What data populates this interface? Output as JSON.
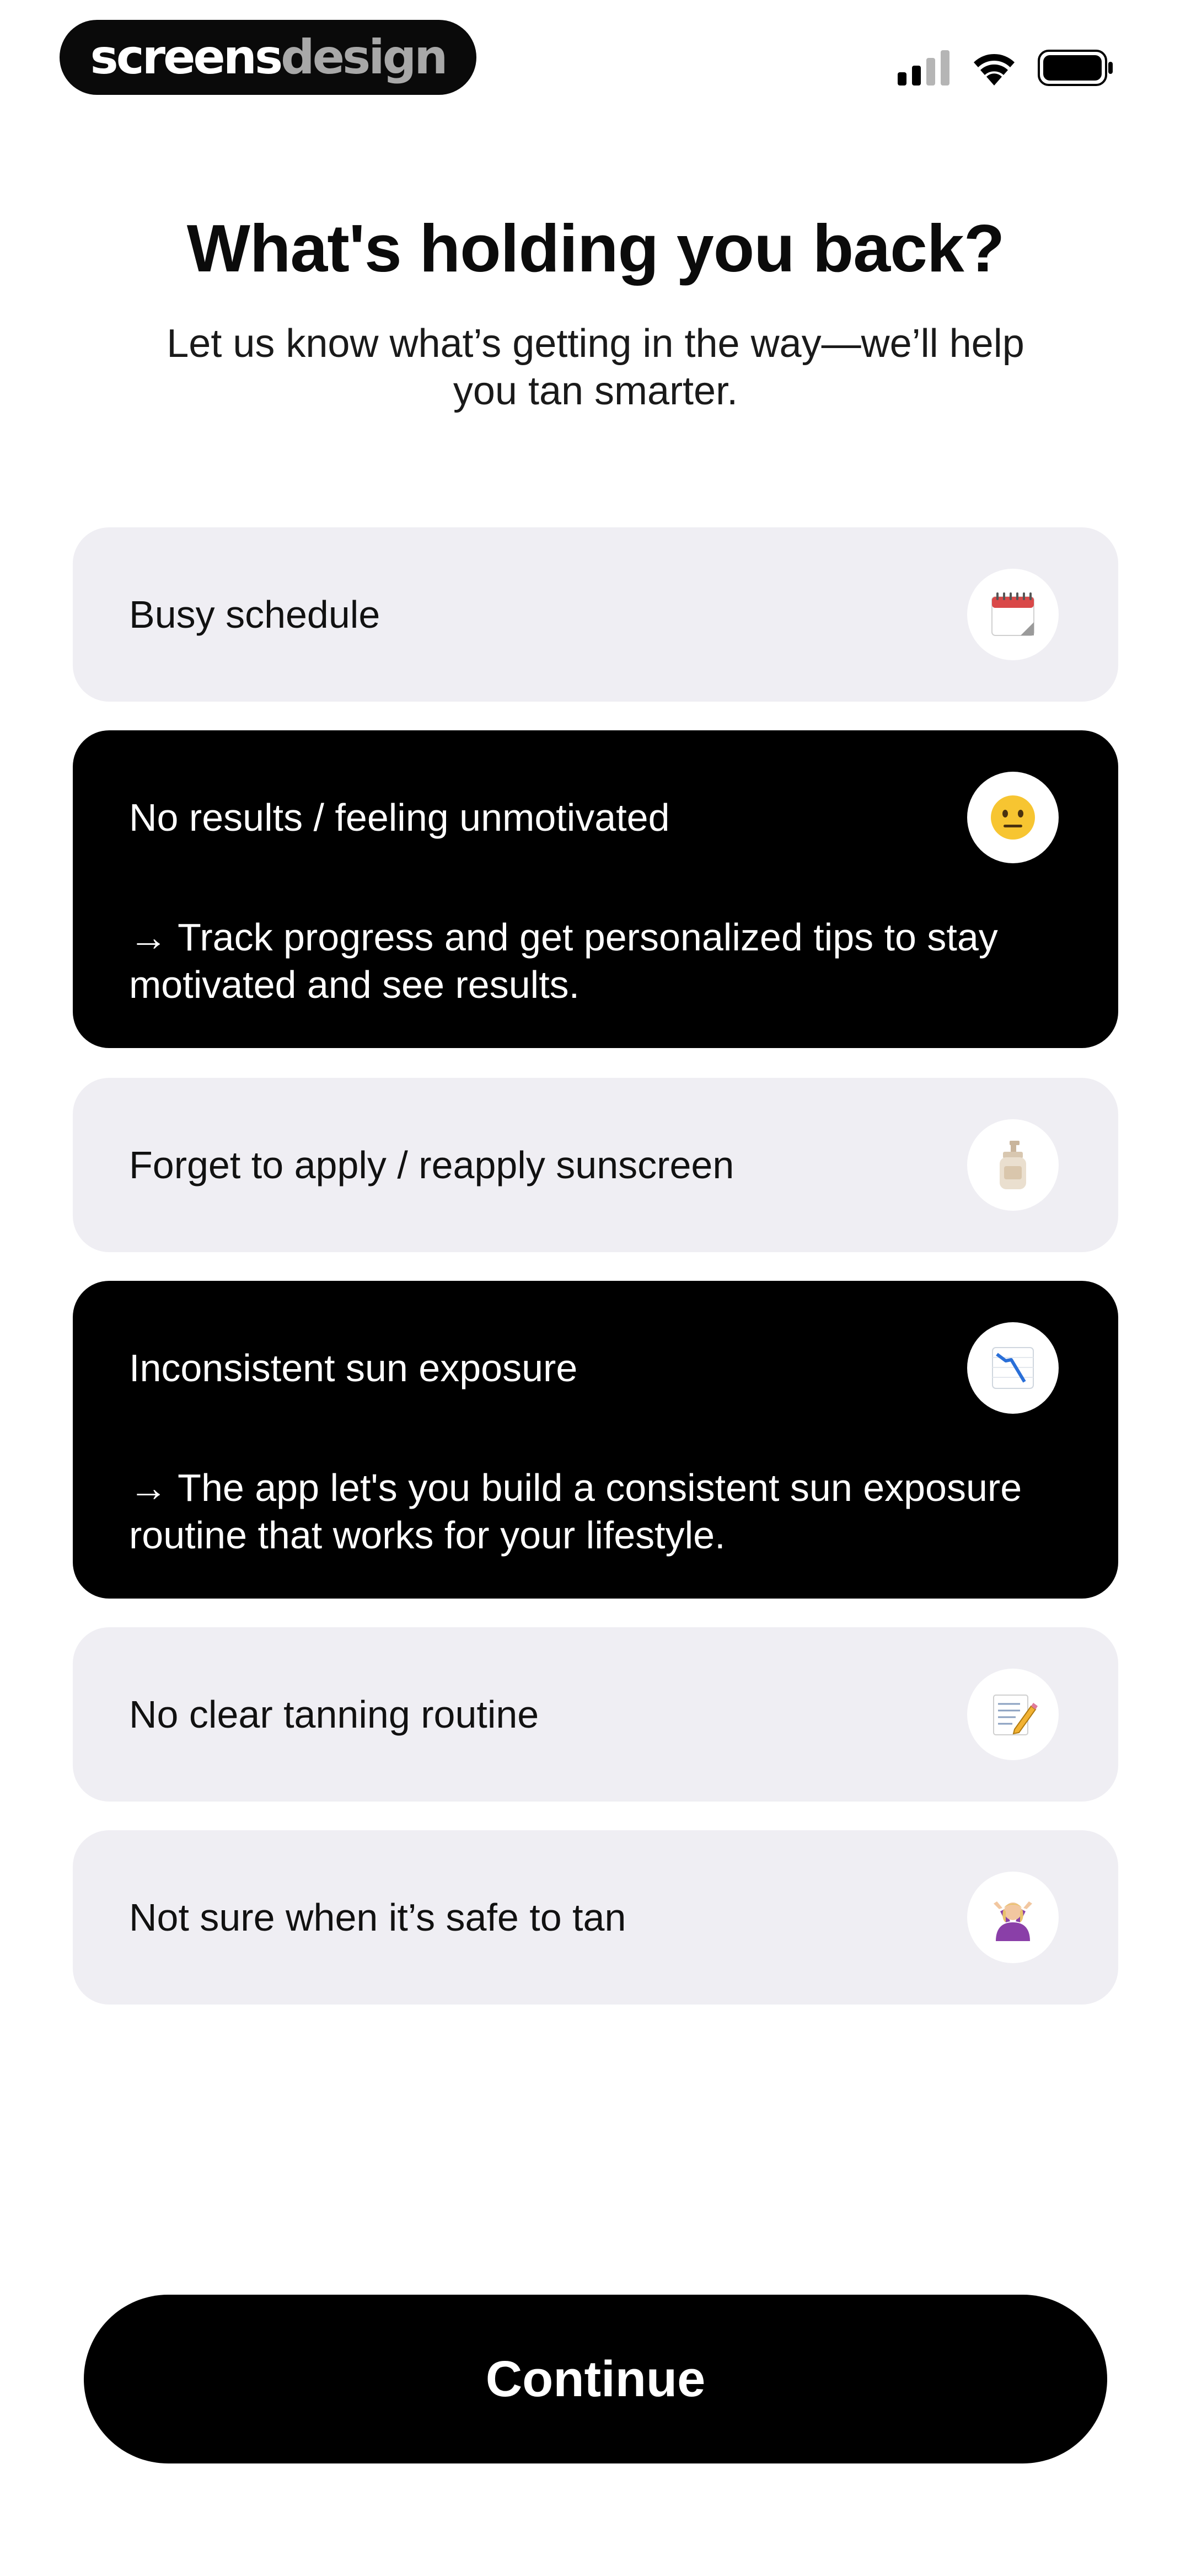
{
  "status_bar": {
    "brand_part1": "screens",
    "brand_part2": "design"
  },
  "header": {
    "title": "What's holding you back?",
    "subtitle": "Let us know what’s getting in the way—we’ll help you tan smarter."
  },
  "options": [
    {
      "label": "Busy schedule",
      "icon": "calendar-icon",
      "selected": false
    },
    {
      "label": "No results / feeling unmotivated",
      "icon": "neutral-face-icon",
      "selected": true,
      "description": "→ Track progress and get personalized tips to stay motivated and see results."
    },
    {
      "label": "Forget to apply / reapply sunscreen",
      "icon": "lotion-bottle-icon",
      "selected": false
    },
    {
      "label": "Inconsistent sun exposure",
      "icon": "chart-decreasing-icon",
      "selected": true,
      "description": "→ The app let's you build a consistent sun exposure routine that works for your lifestyle."
    },
    {
      "label": "No clear tanning routine",
      "icon": "memo-icon",
      "selected": false
    },
    {
      "label": "Not sure when it’s safe to tan",
      "icon": "person-shrugging-icon",
      "selected": false
    }
  ],
  "footer": {
    "continue_label": "Continue"
  },
  "colors": {
    "background": "#ffffff",
    "option_bg": "#efeef3",
    "selected_bg": "#000000",
    "button_bg": "#000000",
    "brand_secondary": "#a8a8a8"
  }
}
